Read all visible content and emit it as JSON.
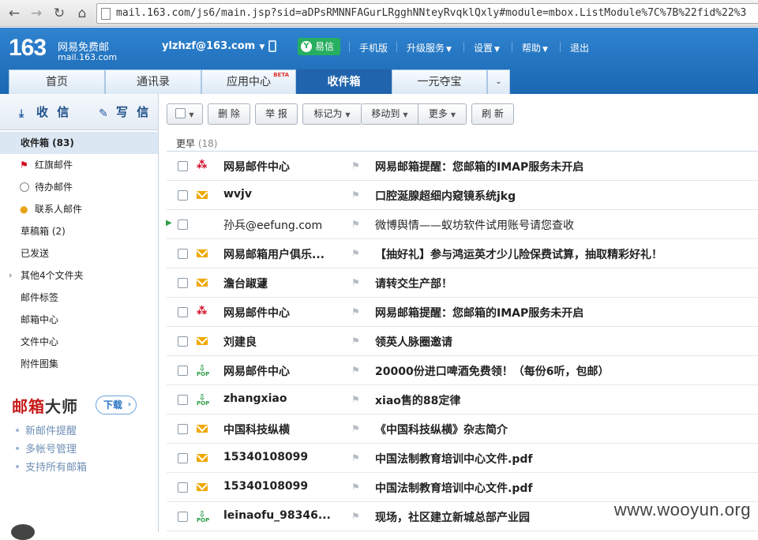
{
  "browser": {
    "url": "mail.163.com/js6/main.jsp?sid=aDPsRMNNFAGurLRgghNNteyRvqklQxly#module=mbox.ListModule%7C%7B%22fid%22%3"
  },
  "header": {
    "logo_num": "163",
    "logo_cn": "网易免费邮",
    "logo_sub": "mail.163.com",
    "user": "ylzhzf@163.com",
    "yixin": "易信",
    "links": [
      "手机版",
      "升级服务",
      "设置",
      "帮助",
      "退出"
    ]
  },
  "tabs": [
    {
      "label": "首页"
    },
    {
      "label": "通讯录"
    },
    {
      "label": "应用中心",
      "badge": "BETA"
    },
    {
      "label": "收件箱"
    },
    {
      "label": "一元夺宝"
    }
  ],
  "sidebar": {
    "receive": "收 信",
    "compose": "写 信",
    "items": [
      {
        "label": "收件箱 (83)"
      },
      {
        "label": "红旗邮件"
      },
      {
        "label": "待办邮件"
      },
      {
        "label": "联系人邮件"
      },
      {
        "label": "草稿箱 (2)"
      },
      {
        "label": "已发送"
      },
      {
        "label": "其他4个文件夹"
      },
      {
        "label": "邮件标签"
      },
      {
        "label": "邮箱中心"
      },
      {
        "label": "文件中心"
      },
      {
        "label": "附件图集"
      }
    ],
    "master_red": "邮箱",
    "master_dark": "大师",
    "download": "下载",
    "features": [
      "新邮件提醒",
      "多帐号管理",
      "支持所有邮箱"
    ]
  },
  "toolbar": {
    "delete": "删 除",
    "report": "举 报",
    "mark_as": "标记为",
    "move_to": "移动到",
    "more": "更多",
    "refresh": "刷 新"
  },
  "list": {
    "group_label": "更早",
    "group_count": "(18)",
    "rows": [
      {
        "from": "网易邮件中心",
        "subject": "网易邮箱提醒：您邮箱的IMAP服务未开启",
        "icon": "ribbon"
      },
      {
        "from": "wvjv",
        "subject": "口腔涎腺超细内窥镜系统jkg",
        "icon": "envelope"
      },
      {
        "from": "孙兵@eefung.com",
        "subject": "微博舆情——蚁坊软件试用账号请您查收",
        "icon": "none"
      },
      {
        "from": "网易邮箱用户俱乐...",
        "subject": "【抽好礼】参与鸿运英才少儿险保费试算，抽取精彩好礼！",
        "icon": "envelope"
      },
      {
        "from": "澹台踧蘧",
        "subject": "请转交生产部！",
        "icon": "envelope"
      },
      {
        "from": "网易邮件中心",
        "subject": "网易邮箱提醒：您邮箱的IMAP服务未开启",
        "icon": "ribbon"
      },
      {
        "from": "刘建良",
        "subject": "领英人脉圈邀请",
        "icon": "envelope"
      },
      {
        "from": "网易邮件中心",
        "subject": "20000份进口啤酒免费领！（每份6听，包邮）",
        "icon": "pop"
      },
      {
        "from": "zhangxiao",
        "subject": "xiao售的88定律",
        "icon": "pop"
      },
      {
        "from": "中国科技纵横",
        "subject": "《中国科技纵横》杂志简介",
        "icon": "envelope"
      },
      {
        "from": "15340108099",
        "subject": "中国法制教育培训中心文件.pdf",
        "icon": "envelope"
      },
      {
        "from": "15340108099",
        "subject": "中国法制教育培训中心文件.pdf",
        "icon": "envelope"
      },
      {
        "from": "leinaofu_98346...",
        "subject": "现场，社区建立新城总部产业园",
        "icon": "pop"
      }
    ],
    "pop_label": "POP"
  },
  "watermark": "www.wooyun.org",
  "colors": {
    "header": "#1f6fbf",
    "active_tab": "#2064ad",
    "yixin": "#27ae60",
    "unread_icon": "#f0a800"
  }
}
